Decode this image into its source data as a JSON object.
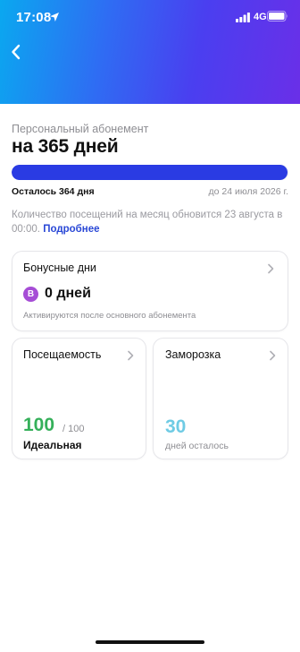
{
  "status_bar": {
    "time": "17:08",
    "network": "4G",
    "icons": [
      "location-arrow-icon",
      "signal-bars-icon",
      "battery-icon"
    ]
  },
  "header": {
    "gradient_colors": [
      "#0aa8f0",
      "#2f6cf3",
      "#4a3ff0",
      "#6a2fe8"
    ],
    "back_icon": "chevron-left-icon"
  },
  "subscription": {
    "label": "Персональный абонемент",
    "title": "на 365 дней",
    "progress_fraction": 0.997,
    "remaining": "Осталось 364 дня",
    "end_date": "до 24 июля 2026 г.",
    "info_text": "Количество посещений на месяц обновится 23 августа в 00:00.",
    "info_link": "Подробнее",
    "accent_color": "#2a3be3"
  },
  "bonus_card": {
    "title": "Бонусные дни",
    "badge_letter": "B",
    "value": "0 дней",
    "note": "Активируются после основного абонемента",
    "badge_color": "#a64dd6"
  },
  "attendance_card": {
    "title": "Посещаемость",
    "value": "100",
    "total": "/ 100",
    "status": "Идеальная",
    "value_color": "#35b05a"
  },
  "freeze_card": {
    "title": "Заморозка",
    "value": "30",
    "note": "дней осталось",
    "value_color": "#6fcbe4"
  }
}
